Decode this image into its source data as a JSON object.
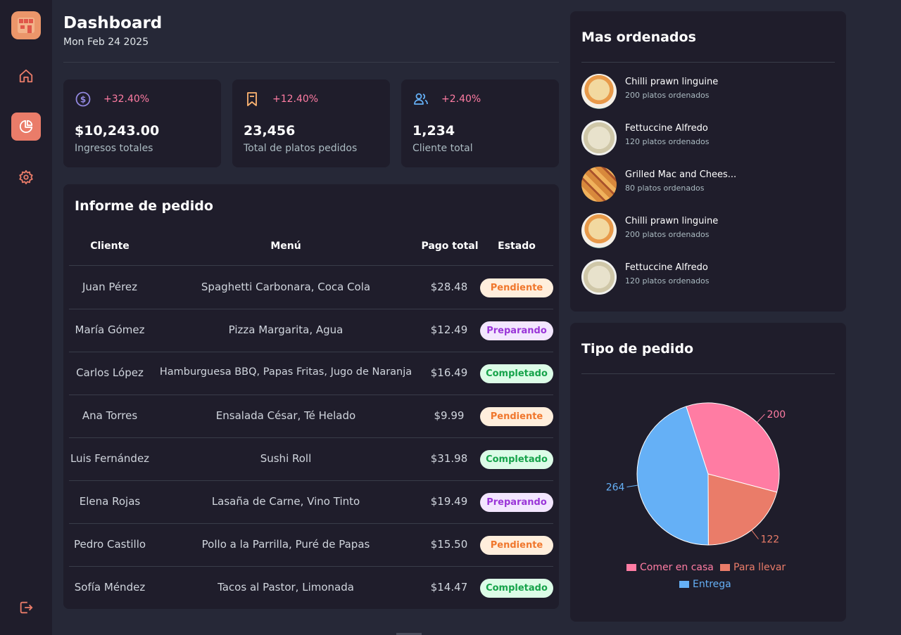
{
  "header": {
    "title": "Dashboard",
    "date": "Mon Feb 24 2025"
  },
  "stats": [
    {
      "icon": "dollar-icon",
      "delta": "+32.40%",
      "value": "$10,243.00",
      "label": "Ingresos totales"
    },
    {
      "icon": "bookmark-icon",
      "delta": "+12.40%",
      "value": "23,456",
      "label": "Total de platos pedidos"
    },
    {
      "icon": "users-icon",
      "delta": "+2.40%",
      "value": "1,234",
      "label": "Cliente total"
    }
  ],
  "orders": {
    "title": "Informe de pedido",
    "columns": [
      "Cliente",
      "Menú",
      "Pago total",
      "Estado"
    ],
    "rows": [
      {
        "client": "Juan Pérez",
        "menu": "Spaghetti Carbonara, Coca Cola",
        "total": "$28.48",
        "status": "Pendiente"
      },
      {
        "client": "María Gómez",
        "menu": "Pizza Margarita, Agua",
        "total": "$12.49",
        "status": "Preparando"
      },
      {
        "client": "Carlos López",
        "menu": "Hamburguesa BBQ, Papas Fritas, Jugo de Naranja",
        "total": "$16.49",
        "status": "Completado"
      },
      {
        "client": "Ana Torres",
        "menu": "Ensalada César, Té Helado",
        "total": "$9.99",
        "status": "Pendiente"
      },
      {
        "client": "Luis Fernández",
        "menu": "Sushi Roll",
        "total": "$31.98",
        "status": "Completado"
      },
      {
        "client": "Elena Rojas",
        "menu": "Lasaña de Carne, Vino Tinto",
        "total": "$19.49",
        "status": "Preparando"
      },
      {
        "client": "Pedro Castillo",
        "menu": "Pollo a la Parrilla, Puré de Papas",
        "total": "$15.50",
        "status": "Pendiente"
      },
      {
        "client": "Sofía Méndez",
        "menu": "Tacos al Pastor, Limonada",
        "total": "$14.47",
        "status": "Completado"
      }
    ]
  },
  "popular": {
    "title": "Mas ordenados",
    "items": [
      {
        "name": "Chilli prawn linguine",
        "count": "200 platos ordenados"
      },
      {
        "name": "Fettuccine Alfredo",
        "count": "120 platos ordenados"
      },
      {
        "name": "Grilled Mac and Chees...",
        "count": "80 platos ordenados"
      },
      {
        "name": "Chilli prawn linguine",
        "count": "200 platos ordenados"
      },
      {
        "name": "Fettuccine Alfredo",
        "count": "120 platos ordenados"
      }
    ]
  },
  "types": {
    "title": "Tipo de pedido"
  },
  "chart_data": {
    "type": "pie",
    "categories": [
      "Comer en casa",
      "Para llevar",
      "Entrega"
    ],
    "values": [
      200,
      122,
      264
    ],
    "colors": [
      "#ff7ca3",
      "#ea7c69",
      "#65b0f6"
    ]
  },
  "colors": {
    "accent": "#ea7c69",
    "panel": "#1f1d2b",
    "background": "#262837"
  }
}
